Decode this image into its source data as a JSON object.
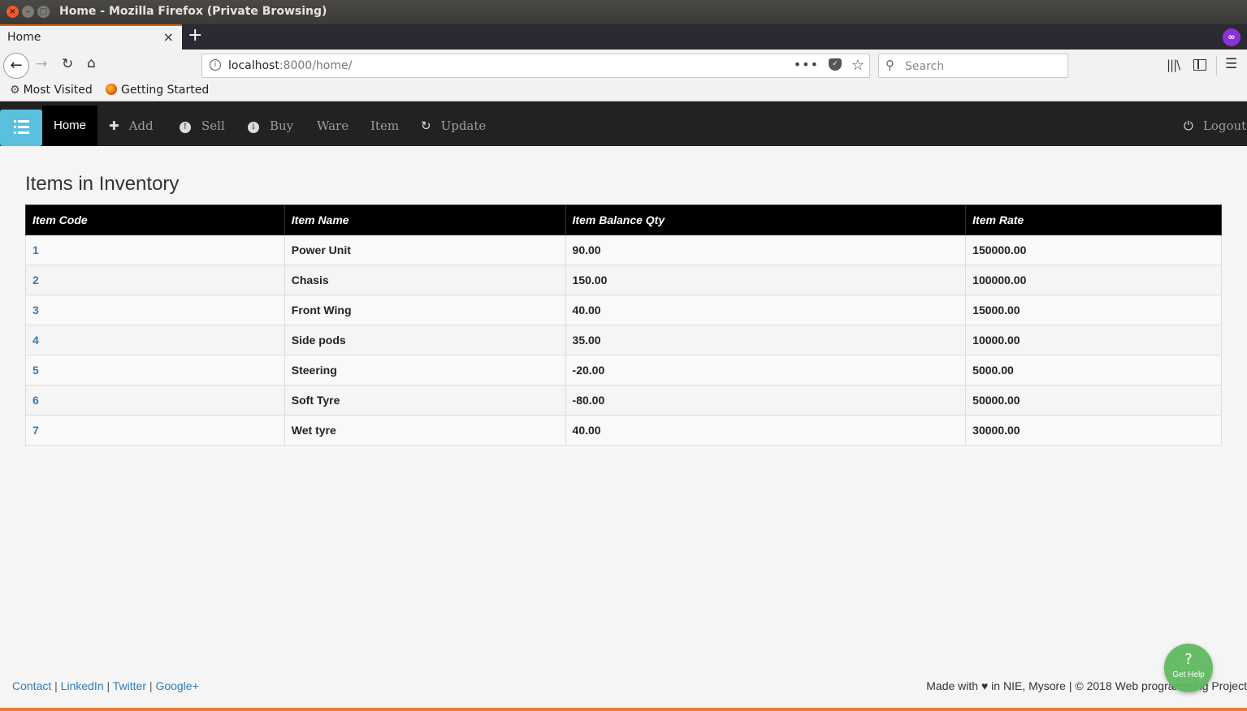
{
  "window": {
    "title": "Home - Mozilla Firefox (Private Browsing)"
  },
  "browser": {
    "tab_label": "Home",
    "tab_close": "×",
    "new_tab": "+",
    "url_host": "localhost",
    "url_rest": ":8000/home/",
    "url_dots": "•••",
    "search_placeholder": "Search"
  },
  "bookmarks": [
    {
      "label": "Most Visited"
    },
    {
      "label": "Getting Started"
    }
  ],
  "appnav": {
    "home": "Home",
    "add": "Add",
    "sell": "Sell",
    "buy": "Buy",
    "ware": "Ware",
    "item": "Item",
    "update": "Update",
    "logout": "Logout"
  },
  "main": {
    "title": "Items in Inventory",
    "columns": [
      "Item Code",
      "Item Name",
      "Item Balance Qty",
      "Item Rate"
    ],
    "rows": [
      [
        "1",
        "Power Unit",
        "90.00",
        "150000.00"
      ],
      [
        "2",
        "Chasis",
        "150.00",
        "100000.00"
      ],
      [
        "3",
        "Front Wing",
        "40.00",
        "15000.00"
      ],
      [
        "4",
        "Side pods",
        "35.00",
        "10000.00"
      ],
      [
        "5",
        "Steering",
        "-20.00",
        "5000.00"
      ],
      [
        "6",
        "Soft Tyre",
        "-80.00",
        "50000.00"
      ],
      [
        "7",
        "Wet tyre",
        "40.00",
        "30000.00"
      ]
    ]
  },
  "footer": {
    "links": [
      "Contact",
      "LinkedIn",
      "Twitter",
      "Google+"
    ],
    "made_with": "Made with",
    "made_rest": "in NIE, Mysore | © 2018 Web programming Project"
  },
  "help": {
    "symbol": "?",
    "label": "Get Help"
  },
  "colors": {
    "accent": "#5bc0de",
    "navbar": "#222222",
    "link": "#337ab7",
    "help": "#5cb85c",
    "firefox": "#e66000"
  }
}
